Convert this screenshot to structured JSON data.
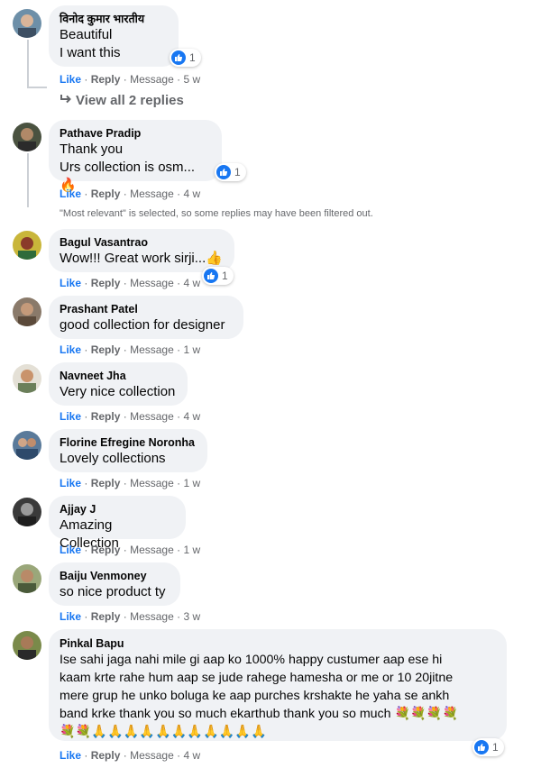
{
  "actions": {
    "like": "Like",
    "reply": "Reply",
    "message": "Message",
    "sep": "·"
  },
  "view_replies": "View all 2 replies",
  "filter_note": "\"Most relevant\" is selected, so some replies may have been filtered out.",
  "comments": [
    {
      "name": "विनोद कुमार भारतीय",
      "lines": [
        "Beautiful",
        "I want this"
      ],
      "time": "5 w",
      "reactions": "1"
    },
    {
      "name": "Pathave Pradip",
      "lines": [
        "Thank you",
        "Urs collection is osm...🔥"
      ],
      "time": "4 w",
      "reactions": "1"
    },
    {
      "name": "Bagul Vasantrao",
      "lines": [
        "Wow!!! Great work sirji...👍"
      ],
      "time": "4 w",
      "reactions": "1"
    },
    {
      "name": "Prashant Patel",
      "lines": [
        "good collection for designer"
      ],
      "time": "1 w"
    },
    {
      "name": "Navneet Jha",
      "lines": [
        "Very nice collection"
      ],
      "time": "4 w"
    },
    {
      "name": "Florine Efregine Noronha",
      "lines": [
        "Lovely collections"
      ],
      "time": "1 w"
    },
    {
      "name": "Ajjay J",
      "lines": [
        "Amazing Collection"
      ],
      "time": "1 w"
    },
    {
      "name": "Baiju Venmoney",
      "lines": [
        "so nice product ty"
      ],
      "time": "3 w"
    },
    {
      "name": "Pinkal Bapu",
      "lines": [
        "Ise sahi jaga nahi mile gi aap ko 1000% happy custumer aap ese hi",
        "kaam krte rahe hum aap se jude rahege hamesha or me or 10 20jitne",
        "mere grup he unko boluga ke aap purches krshakte he yaha se ankh",
        "band krke thank you so much ekarthub thank you so much 💐💐💐💐",
        "💐💐🙏🙏🙏🙏🙏🙏🙏🙏🙏🙏🙏"
      ],
      "time": "4 w",
      "reactions": "1"
    }
  ],
  "colors": {
    "link": "#1877f2",
    "meta": "#65676b",
    "bubble": "#f0f2f5",
    "text": "#050505"
  },
  "icons": {
    "reaction": "like-icon",
    "reply_arrow": "reply-arrow-icon"
  }
}
